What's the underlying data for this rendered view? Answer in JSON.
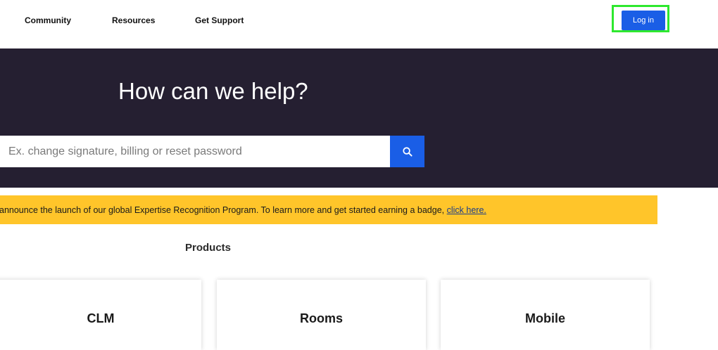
{
  "nav": {
    "items": [
      {
        "label": "Community"
      },
      {
        "label": "Resources"
      },
      {
        "label": "Get Support"
      }
    ],
    "login_label": "Log in"
  },
  "hero": {
    "title": "How can we help?",
    "search_placeholder": "Ex. change signature, billing or reset password",
    "search_value": ""
  },
  "banner": {
    "text": "announce the launch of our global Expertise Recognition Program. To learn more and get started earning a badge, ",
    "link_label": "click here."
  },
  "products": {
    "title": "Products",
    "cards": [
      {
        "label": "CLM"
      },
      {
        "label": "Rooms"
      },
      {
        "label": "Mobile"
      }
    ]
  },
  "colors": {
    "accent": "#1a5ee6",
    "hero_bg": "#251f31",
    "banner_bg": "#ffc52a",
    "highlight": "#2ee82e"
  },
  "icons": {
    "search": "search-icon"
  }
}
